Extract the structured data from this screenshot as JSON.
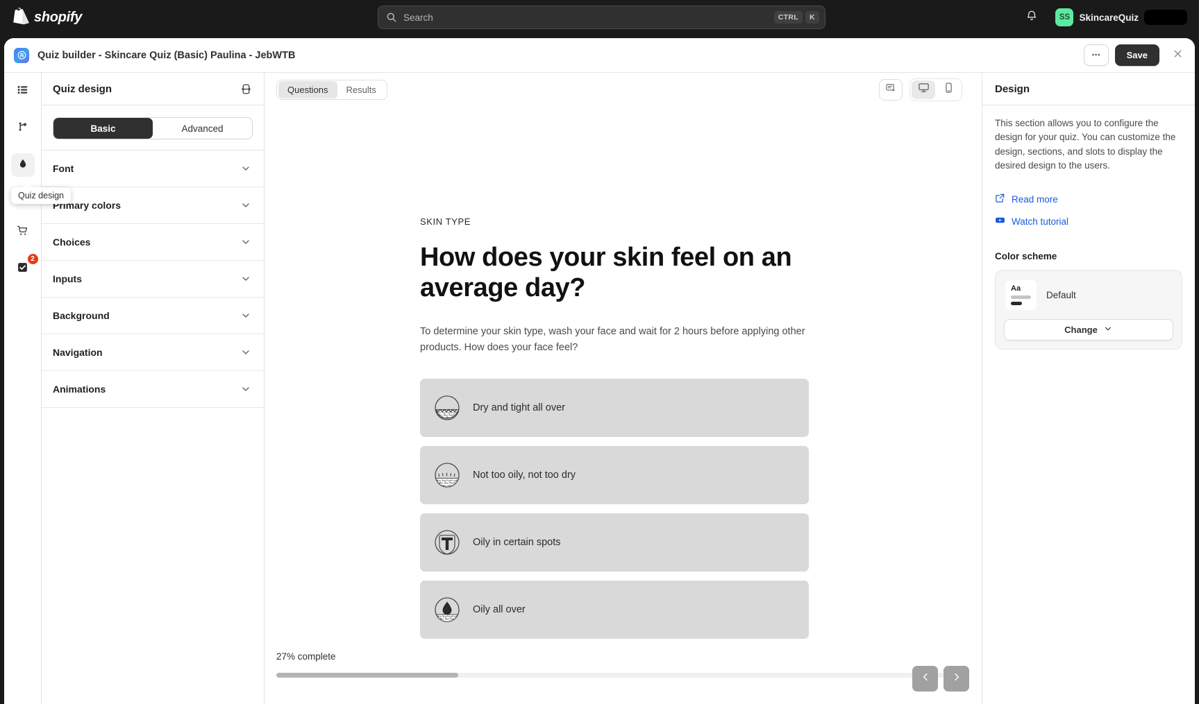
{
  "topbar": {
    "brand": "shopify",
    "search": {
      "placeholder": "Search",
      "kbd_ctrl": "CTRL",
      "kbd_key": "K"
    },
    "notifications_icon": "bell-icon",
    "store": {
      "initials": "SS",
      "name": "SkincareQuiz"
    }
  },
  "modal": {
    "title": "Quiz builder - Skincare Quiz (Basic) Paulina - JebWTB",
    "more_label": "...",
    "save_label": "Save",
    "close_icon": "close-icon"
  },
  "rail": {
    "items": [
      {
        "name": "list-icon",
        "badge": ""
      },
      {
        "name": "branch-icon",
        "badge": ""
      },
      {
        "name": "droplet-icon",
        "badge": ""
      },
      {
        "name": "cart-icon",
        "badge": ""
      },
      {
        "name": "checkbox-icon",
        "badge": "2"
      }
    ],
    "tooltip": "Quiz design"
  },
  "left_panel": {
    "title": "Quiz design",
    "header_icon": "resize-horizontal-icon",
    "segments": [
      {
        "label": "Basic",
        "active": true
      },
      {
        "label": "Advanced",
        "active": false
      }
    ],
    "accordions": [
      {
        "label": "Font"
      },
      {
        "label": "Primary colors"
      },
      {
        "label": "Choices"
      },
      {
        "label": "Inputs"
      },
      {
        "label": "Background"
      },
      {
        "label": "Navigation"
      },
      {
        "label": "Animations"
      }
    ]
  },
  "center": {
    "tabs": [
      {
        "label": "Questions",
        "active": true
      },
      {
        "label": "Results",
        "active": false
      }
    ],
    "devices": {
      "preview_icon": "preview-select-icon",
      "desktop_icon": "desktop-icon",
      "mobile_icon": "mobile-icon",
      "active": "desktop"
    },
    "quiz": {
      "eyebrow": "SKIN TYPE",
      "title": "How does your skin feel on an average day?",
      "description": "To determine your skin type, wash your face and wait for 2 hours before applying other products. How does your face feel?",
      "choices": [
        {
          "label": "Dry and tight all over",
          "icon": "dry-skin-icon"
        },
        {
          "label": "Not too oily, not too dry",
          "icon": "normal-skin-icon"
        },
        {
          "label": "Oily in certain spots",
          "icon": "t-zone-icon"
        },
        {
          "label": "Oily all over",
          "icon": "oily-skin-icon"
        }
      ],
      "progress_label": "27% complete",
      "progress_percent": 27,
      "progress_fill_ratio": 27,
      "prev_icon": "chevron-left-icon",
      "next_icon": "chevron-right-icon"
    }
  },
  "right_panel": {
    "title": "Design",
    "description": "This section allows you to configure the design for your quiz. You can customize the design, sections, and slots to display the desired design to the users.",
    "links": [
      {
        "label": "Read more",
        "icon": "external-link-icon"
      },
      {
        "label": "Watch tutorial",
        "icon": "youtube-icon"
      }
    ],
    "color_scheme": {
      "section_title": "Color scheme",
      "swatch_text": "Aa",
      "name": "Default",
      "change_label": "Change",
      "chevron_icon": "chevron-down-icon"
    }
  },
  "colors": {
    "topbar_bg": "#1a1a1a",
    "accent_link": "#165cdb",
    "badge_red": "#e03e1a",
    "avatar_green": "#5ee9a0",
    "choice_bg": "#d9d9d9",
    "save_btn": "#303030"
  }
}
